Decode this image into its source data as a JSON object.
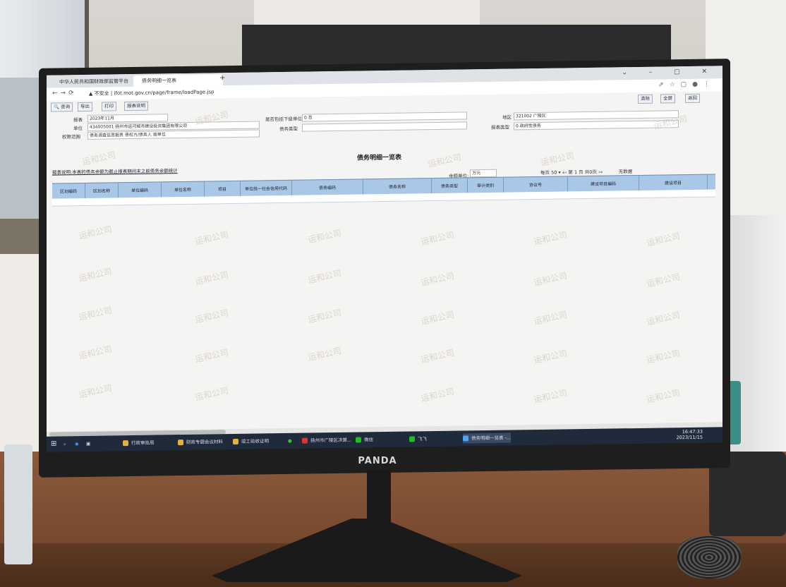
{
  "browser": {
    "tab1": "中华人民共和国财政部监管平台",
    "tab2": "债务明细一览表",
    "security": "不安全",
    "url": "ifot.mot.gov.cn/page/frame/loadPage.jsp"
  },
  "toolbar": {
    "query": "查询",
    "export": "导出",
    "print": "打印",
    "explain": "报表说明",
    "clear": "清除",
    "fullscreen": "全屏",
    "back": "返回"
  },
  "form": {
    "period_label": "报表",
    "period_value": "2023年11月",
    "unit_label": "单位",
    "unit_value": "434005001 扬州市运河城市建设投资集团有限公司",
    "scope_label": "权限范围",
    "scope_value": "债务调查信息报表 债权方/债务人 按单位",
    "include_label": "是否包括下级单位",
    "include_value": "0.否",
    "debt_type_label": "债务类型",
    "region_label": "地区",
    "region_value": "321002 广陵区",
    "report_type_label": "报表类型",
    "report_type_value": "0.政府性债务"
  },
  "page_title": "债务明细一览表",
  "note": "报表说明:本表的债务余额为截止报表期间末之前债务余额统计",
  "currency_label": "金额单位:",
  "currency_value": "万元",
  "pager": {
    "per_page": "每页 50",
    "page_prefix": "第",
    "page_num": "1",
    "page_total": "页 共0页",
    "empty": "无数据"
  },
  "columns": [
    "区划编码",
    "区划名称",
    "单位编码",
    "单位名称",
    "项目",
    "单位统一社会信用代码",
    "债务编码",
    "债务名称",
    "债务类型",
    "审计类别",
    "协议号",
    "建设项目编码",
    "建设项目"
  ],
  "watermark": "运和公司",
  "taskbar": {
    "items": [
      "行政审批局",
      "财政专题会议材料",
      "竣工验收证明",
      "扬州市广陵区决算...",
      "微信",
      "飞飞",
      "债务明细一览表 -..."
    ],
    "time": "16:47:33",
    "date": "2023/11/15"
  },
  "monitor_brand": "PANDA"
}
